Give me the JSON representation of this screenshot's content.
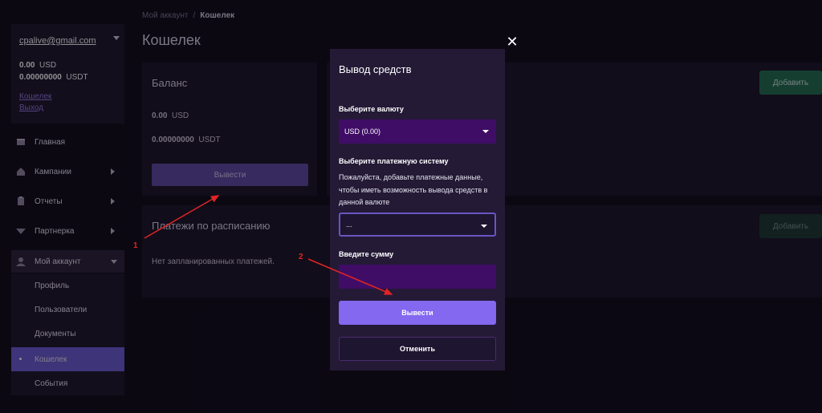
{
  "colors": {
    "accent": "#8468ef",
    "active_nav": "#6a5bd1",
    "add_button": "#1f6e4f",
    "select_fill": "#3f0d66",
    "annotation": "#e02424"
  },
  "sidebar": {
    "account": {
      "email": "cpalive@gmail.com",
      "balances": [
        {
          "amount": "0.00",
          "currency": "USD"
        },
        {
          "amount": "0.00000000",
          "currency": "USDT"
        }
      ],
      "links": [
        "Кошелек",
        "Выход"
      ]
    },
    "nav": [
      {
        "label": "Главная",
        "icon": "home-icon"
      },
      {
        "label": "Кампании",
        "icon": "campaigns-icon"
      },
      {
        "label": "Отчеты",
        "icon": "reports-icon"
      },
      {
        "label": "Партнерка",
        "icon": "partner-icon"
      },
      {
        "label": "Мой аккаунт",
        "icon": "user-icon"
      }
    ],
    "submenu": [
      "Профиль",
      "Пользователи",
      "Документы",
      "Кошелек",
      "События"
    ]
  },
  "breadcrumb": {
    "parent": "Мой аккаунт",
    "separator": "/",
    "current": "Кошелек"
  },
  "page_title": "Кошелек",
  "balance_card": {
    "title": "Баланс",
    "lines": [
      {
        "amount": "0.00",
        "currency": "USD"
      },
      {
        "amount": "0.00000000",
        "currency": "USDT"
      }
    ],
    "withdraw_label": "Вывести"
  },
  "add_buttons": [
    "Добавить",
    "Добавить"
  ],
  "scheduled_card": {
    "title": "Платежи по расписанию",
    "empty_text": "Нет запланированных платежей."
  },
  "modal": {
    "title": "Вывод средств",
    "currency_label": "Выберите валюту",
    "currency_value": "USD (0.00)",
    "payment_label": "Выберите платежную систему",
    "payment_note": "Пожалуйста, добавьте платежные данные, чтобы иметь возможность вывода средств в данной валюте",
    "payment_value": "...",
    "amount_label": "Введите сумму",
    "amount_value": "",
    "submit_label": "Вывести",
    "cancel_label": "Отменить"
  },
  "annotations": [
    "1",
    "2"
  ]
}
